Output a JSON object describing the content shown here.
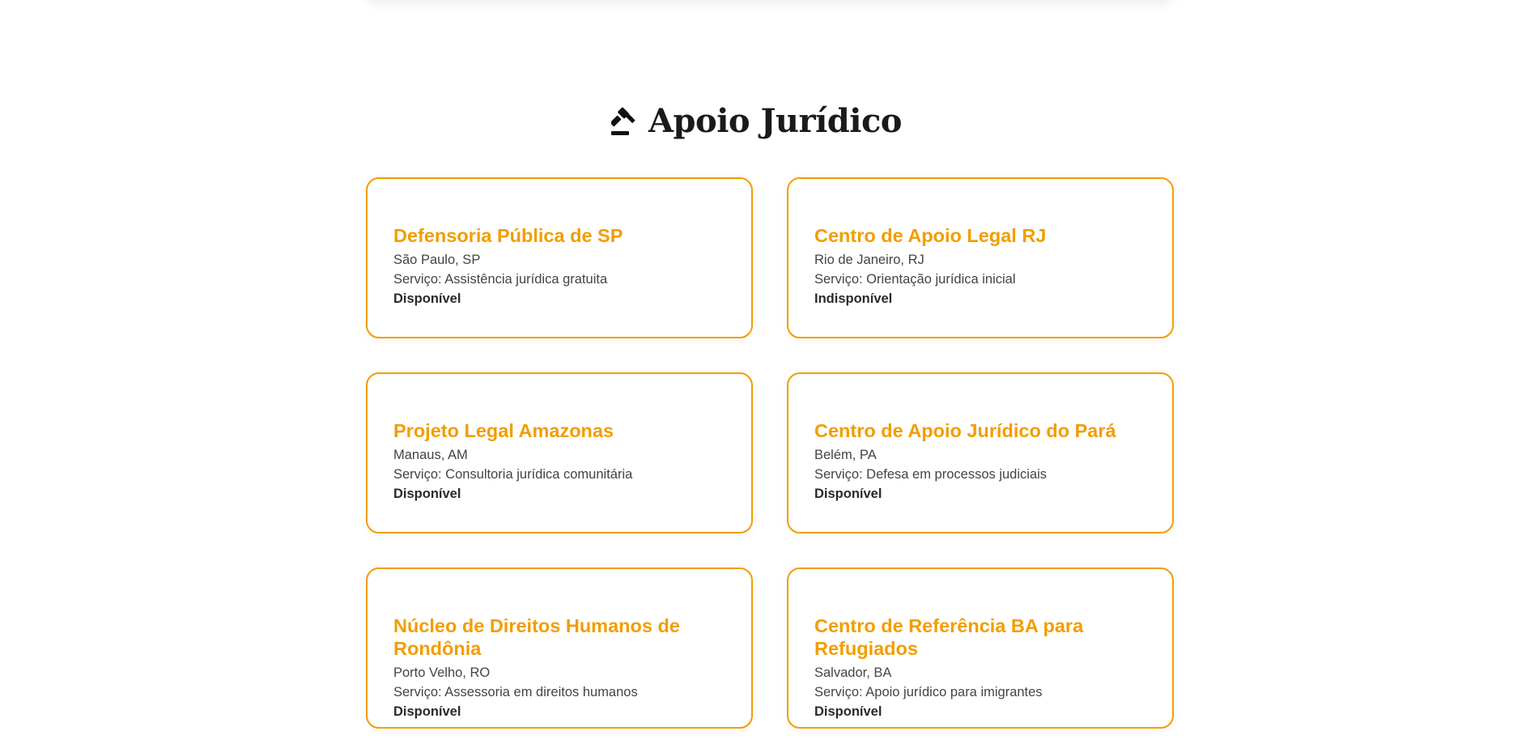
{
  "section": {
    "icon": "gavel-icon",
    "title": "Apoio Jurídico"
  },
  "colors": {
    "accent": "#f29d00",
    "text": "#444444",
    "title_text": "#1a1a1a"
  },
  "cards": [
    {
      "name": "Defensoria Pública de SP",
      "location": "São Paulo, SP",
      "service": "Serviço: Assistência jurídica gratuita",
      "status": "Disponível"
    },
    {
      "name": "Centro de Apoio Legal RJ",
      "location": "Rio de Janeiro, RJ",
      "service": "Serviço: Orientação jurídica inicial",
      "status": "Indisponível"
    },
    {
      "name": "Projeto Legal Amazonas",
      "location": "Manaus, AM",
      "service": "Serviço: Consultoria jurídica comunitária",
      "status": "Disponível"
    },
    {
      "name": "Centro de Apoio Jurídico do Pará",
      "location": "Belém, PA",
      "service": "Serviço: Defesa em processos judiciais",
      "status": "Disponível"
    },
    {
      "name": "Núcleo de Direitos Humanos de Rondônia",
      "location": "Porto Velho, RO",
      "service": "Serviço: Assessoria em direitos humanos",
      "status": "Disponível"
    },
    {
      "name": "Centro de Referência BA para Refugiados",
      "location": "Salvador, BA",
      "service": "Serviço: Apoio jurídico para imigrantes",
      "status": "Disponível"
    }
  ]
}
